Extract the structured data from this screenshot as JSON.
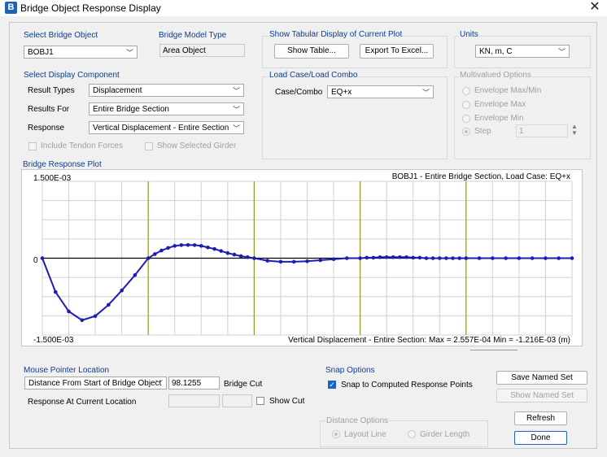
{
  "window": {
    "title": "Bridge Object Response Display",
    "icon": "B"
  },
  "select_bridge_object": {
    "label": "Select Bridge Object",
    "value": "BOBJ1"
  },
  "bridge_model_type": {
    "label": "Bridge Model Type",
    "value": "Area Object"
  },
  "tabular": {
    "label": "Show Tabular Display of Current Plot",
    "show_table": "Show Table...",
    "export_excel": "Export To Excel..."
  },
  "units": {
    "label": "Units",
    "value": "KN, m, C"
  },
  "display_component": {
    "label": "Select Display Component",
    "result_types_label": "Result Types",
    "result_types_value": "Displacement",
    "results_for_label": "Results For",
    "results_for_value": "Entire Bridge Section",
    "response_label": "Response",
    "response_value": "Vertical Displacement - Entire Section",
    "include_tendon": "Include Tendon Forces",
    "show_girder": "Show Selected Girder"
  },
  "load_case": {
    "label": "Load Case/Load Combo",
    "case_label": "Case/Combo",
    "case_value": "EQ+x"
  },
  "multivalued": {
    "label": "Multivalued Options",
    "env_maxmin": "Envelope Max/Min",
    "env_max": "Envelope Max",
    "env_min": "Envelope Min",
    "step": "Step",
    "step_value": "1"
  },
  "plot": {
    "label": "Bridge Response Plot",
    "header": "BOBJ1 - Entire Bridge Section,  Load Case: EQ+x",
    "footer": "Vertical Displacement - Entire Section:  Max = 2.557E-04   Min = -1.216E-03  (m)",
    "y_top": "1.500E-03",
    "y_mid": "0",
    "y_bottom": "-1.500E-03"
  },
  "chart_data": {
    "type": "line",
    "ylim": [
      -0.0015,
      0.0015
    ],
    "xlim": [
      0,
      1
    ],
    "grid": true,
    "series": [
      {
        "x": [
          0,
          0.025,
          0.05,
          0.075,
          0.1,
          0.125,
          0.15,
          0.175,
          0.2,
          0.2125,
          0.225,
          0.2375,
          0.25,
          0.2625,
          0.275,
          0.2875,
          0.3,
          0.3125,
          0.325,
          0.3375,
          0.35,
          0.3625,
          0.375,
          0.3875,
          0.4,
          0.425,
          0.45,
          0.475,
          0.5,
          0.525,
          0.55,
          0.575,
          0.6,
          0.6125,
          0.625,
          0.6375,
          0.65,
          0.6625,
          0.675,
          0.6875,
          0.7,
          0.7125,
          0.725,
          0.7375,
          0.75,
          0.7625,
          0.775,
          0.7875,
          0.8,
          0.825,
          0.85,
          0.875,
          0.9,
          0.925,
          0.95,
          0.975,
          1.0
        ],
        "y": [
          0,
          -0.00066,
          -0.00104,
          -0.00121,
          -0.00113,
          -0.00091,
          -0.00063,
          -0.00033,
          0.0,
          8e-05,
          0.00015,
          0.0002,
          0.00024,
          0.000255,
          0.000257,
          0.000255,
          0.00024,
          0.00021,
          0.00018,
          0.00014,
          0.0001,
          7e-05,
          4e-05,
          2e-05,
          0.0,
          -5e-05,
          -7e-05,
          -7e-05,
          -6e-05,
          -4e-05,
          -2e-05,
          0.0,
          0.0,
          1e-05,
          1e-05,
          2e-05,
          2e-05,
          2e-05,
          2e-05,
          2e-05,
          1e-05,
          1e-05,
          0.0,
          0.0,
          0.0,
          0.0,
          0.0,
          0.0,
          0.0,
          0.0,
          0.0,
          0.0,
          0.0,
          0.0,
          0.0,
          0.0,
          0.0
        ]
      }
    ],
    "span_lines_x": [
      0.2,
      0.4,
      0.6,
      0.8
    ],
    "colors": {
      "series": "#1d1db0",
      "span_lines": "#9a9a2a",
      "grid": "#d0d0d0",
      "zero": "#000000"
    }
  },
  "mouse_pointer": {
    "label": "Mouse Pointer Location",
    "mode_value": "Distance From Start of Bridge Object",
    "distance_value": "98.1255",
    "bridge_cut_label": "Bridge Cut",
    "response_label": "Response At Current Location",
    "show_cut": "Show Cut"
  },
  "snap": {
    "label": "Snap Options",
    "snap_label": "Snap to Computed Response Points"
  },
  "distance_options": {
    "label": "Distance Options",
    "layout_line": "Layout Line",
    "girder_length": "Girder Length"
  },
  "buttons": {
    "save_named": "Save Named Set",
    "show_named": "Show Named Set",
    "refresh": "Refresh",
    "done": "Done"
  }
}
